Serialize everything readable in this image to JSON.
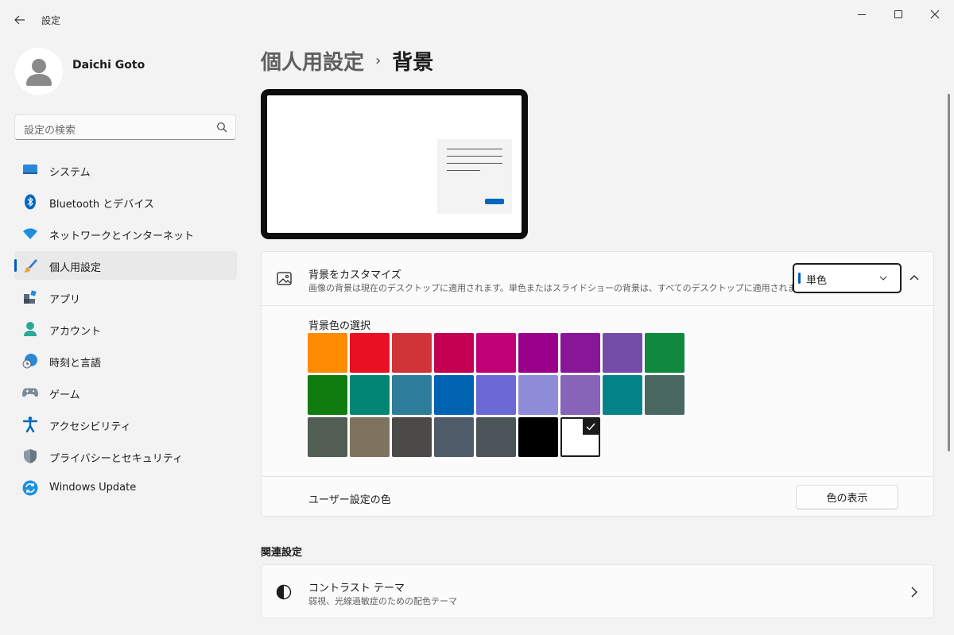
{
  "window": {
    "title": "設定"
  },
  "user": {
    "name": "Daichi Goto"
  },
  "search": {
    "placeholder": "設定の検索"
  },
  "sidebar": {
    "items": [
      {
        "label": "システム",
        "icon": "system-icon"
      },
      {
        "label": "Bluetooth とデバイス",
        "icon": "bluetooth-icon"
      },
      {
        "label": "ネットワークとインターネット",
        "icon": "network-icon"
      },
      {
        "label": "個人用設定",
        "icon": "brush-icon",
        "selected": true
      },
      {
        "label": "アプリ",
        "icon": "apps-icon"
      },
      {
        "label": "アカウント",
        "icon": "account-icon"
      },
      {
        "label": "時刻と言語",
        "icon": "time-language-icon"
      },
      {
        "label": "ゲーム",
        "icon": "gamepad-icon"
      },
      {
        "label": "アクセシビリティ",
        "icon": "accessibility-icon"
      },
      {
        "label": "プライバシーとセキュリティ",
        "icon": "shield-icon"
      },
      {
        "label": "Windows Update",
        "icon": "windows-update-icon"
      }
    ]
  },
  "breadcrumb": {
    "parent": "個人用設定",
    "separator": "›",
    "current": "背景"
  },
  "background_card": {
    "title": "背景をカスタマイズ",
    "description": "画像の背景は現在のデスクトップに適用されます。単色またはスライドショーの背景は、すべてのデスクトップに適用されます。",
    "dropdown_value": "単色"
  },
  "palette": {
    "title": "背景色の選択",
    "colors": [
      "#ff8c00",
      "#e81123",
      "#d13438",
      "#c30052",
      "#bf0077",
      "#9a0089",
      "#881798",
      "#744da9",
      "#10893e",
      "#107c10",
      "#018574",
      "#2d7d9a",
      "#0063b1",
      "#6b69d6",
      "#8e8cd8",
      "#8764b8",
      "#038387",
      "#486860",
      "#525e54",
      "#7e735f",
      "#4c4a48",
      "#515c6b",
      "#4a5459",
      "#000000",
      "#ffffff"
    ],
    "selected_index": 24
  },
  "custom_color": {
    "label": "ユーザー設定の色",
    "button": "色の表示"
  },
  "related": {
    "title": "関連設定",
    "contrast_title": "コントラスト テーマ",
    "contrast_desc": "弱視、光線過敏症のための配色テーマ"
  },
  "accent_color": "#005fb8"
}
